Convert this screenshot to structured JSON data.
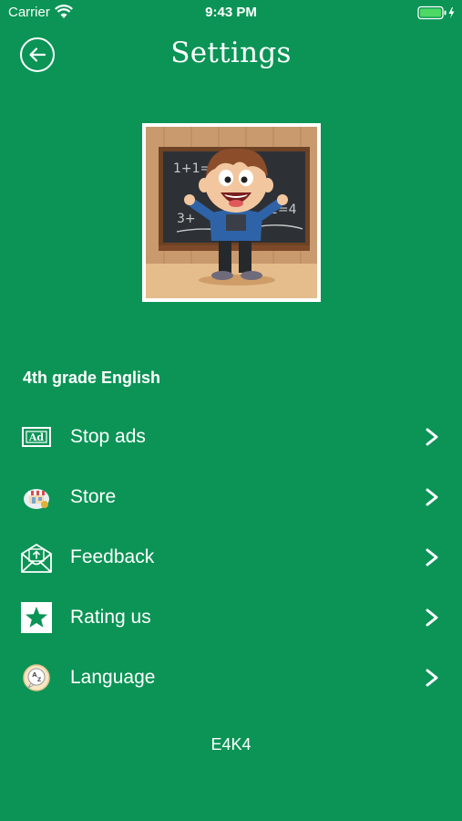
{
  "status_bar": {
    "carrier": "Carrier",
    "time": "9:43 PM",
    "battery_color": "#4cd964"
  },
  "header": {
    "title": "Settings",
    "back_icon": "back-arrow-circle-icon"
  },
  "section": {
    "heading": "4th grade English"
  },
  "menu": [
    {
      "label": "Stop ads",
      "icon": "ad-icon"
    },
    {
      "label": "Store",
      "icon": "store-icon"
    },
    {
      "label": "Feedback",
      "icon": "envelope-icon"
    },
    {
      "label": "Rating us",
      "icon": "star-icon"
    },
    {
      "label": "Language",
      "icon": "language-icon"
    }
  ],
  "footer": {
    "version_code": "E4K4"
  },
  "colors": {
    "background": "#0b9456",
    "text": "#ffffff"
  }
}
